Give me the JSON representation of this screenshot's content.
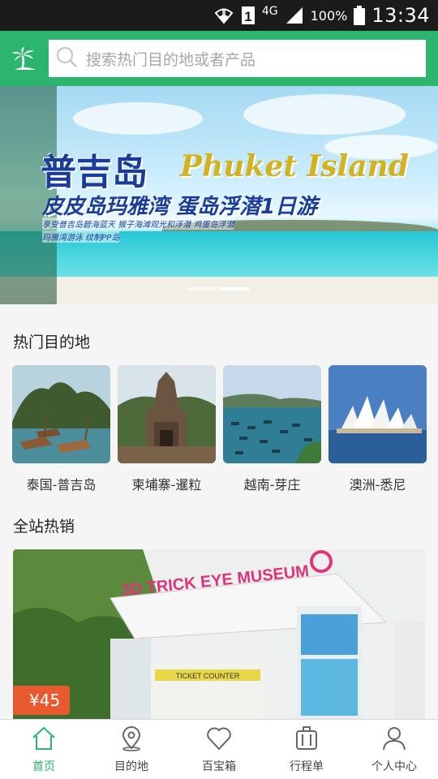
{
  "status_bar": {
    "network": "4G",
    "battery": "100%",
    "time": "13:34",
    "sim": "1"
  },
  "header": {
    "logo_icon": "palm-tree-icon",
    "search_placeholder": "搜索热门目的地或者产品"
  },
  "banner": {
    "title_cn": "普吉岛",
    "title_en": "Phuket Island",
    "subtitle": "皮皮岛玛雅湾  蛋岛浮潜1日游",
    "line1": "享受普吉岛碧海蓝天  猴子海滩观光和浮潜  鸡蛋岛浮潜",
    "line2": "玛雅湾游泳  纹制PP岛",
    "slide_count": 2,
    "active_slide": 2
  },
  "hot_destinations": {
    "title": "热门目的地",
    "items": [
      {
        "label": "泰国-普吉岛",
        "icon": "thailand-phuket-photo"
      },
      {
        "label": "柬埔寨-暹粒",
        "icon": "cambodia-siemreap-photo"
      },
      {
        "label": "越南-芽庄",
        "icon": "vietnam-nhatrang-photo"
      },
      {
        "label": "澳洲-悉尼",
        "icon": "australia-sydney-photo"
      }
    ]
  },
  "hot_sales": {
    "title": "全站热销",
    "card": {
      "sign_text": "3D TRICK EYE MUSEUM",
      "counter_text": "TICKET COUNTER",
      "price": "¥45"
    }
  },
  "tabbar": {
    "items": [
      {
        "label": "首页",
        "icon": "home-icon",
        "active": true
      },
      {
        "label": "目的地",
        "icon": "location-pin-icon",
        "active": false
      },
      {
        "label": "百宝箱",
        "icon": "heart-icon",
        "active": false
      },
      {
        "label": "行程单",
        "icon": "luggage-icon",
        "active": false
      },
      {
        "label": "个人中心",
        "icon": "user-icon",
        "active": false
      }
    ]
  },
  "colors": {
    "brand_green": "#2bb56d",
    "price_orange": "#e8592f",
    "status_bar": "#1b1b1b"
  }
}
